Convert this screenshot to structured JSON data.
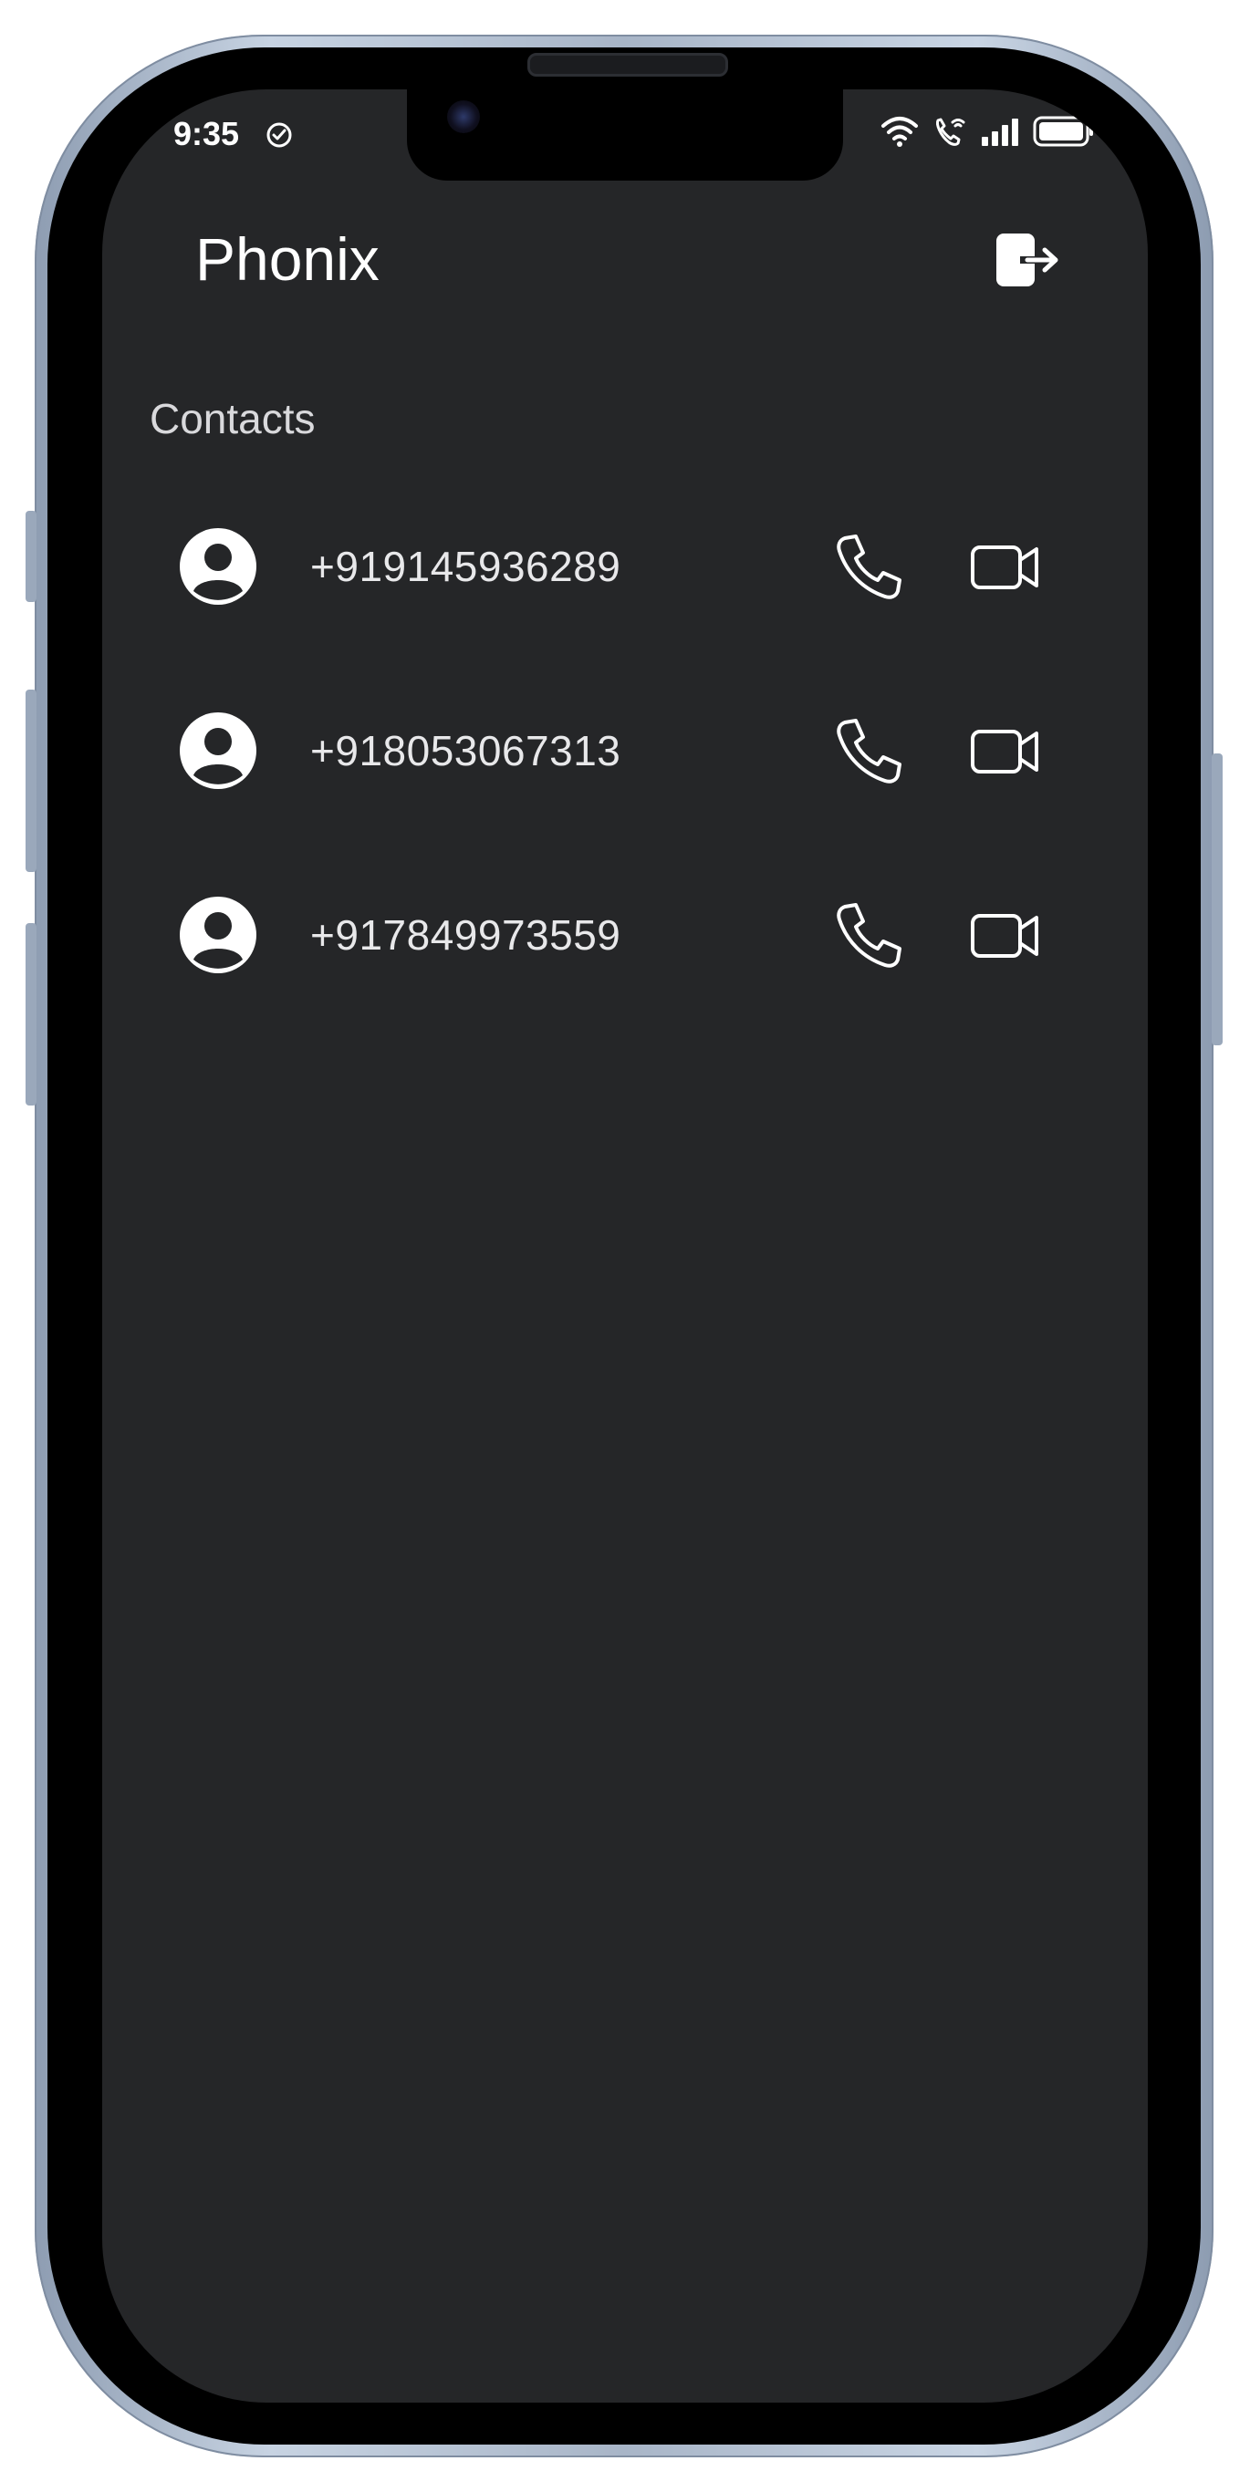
{
  "status_bar": {
    "time": "9:35",
    "battery_dot_color": "#2bd34d"
  },
  "header": {
    "title": "Phonix",
    "logout_icon": "logout-icon"
  },
  "section": {
    "label": "Contacts"
  },
  "contacts": [
    {
      "number": "+919145936289"
    },
    {
      "number": "+918053067313"
    },
    {
      "number": "+917849973559"
    }
  ],
  "icons": {
    "avatar": "account-circle-icon",
    "call": "phone-icon",
    "video": "video-camera-icon"
  },
  "colors": {
    "background": "#252628",
    "text": "#ffffff",
    "muted_text": "#d9d9dc"
  }
}
